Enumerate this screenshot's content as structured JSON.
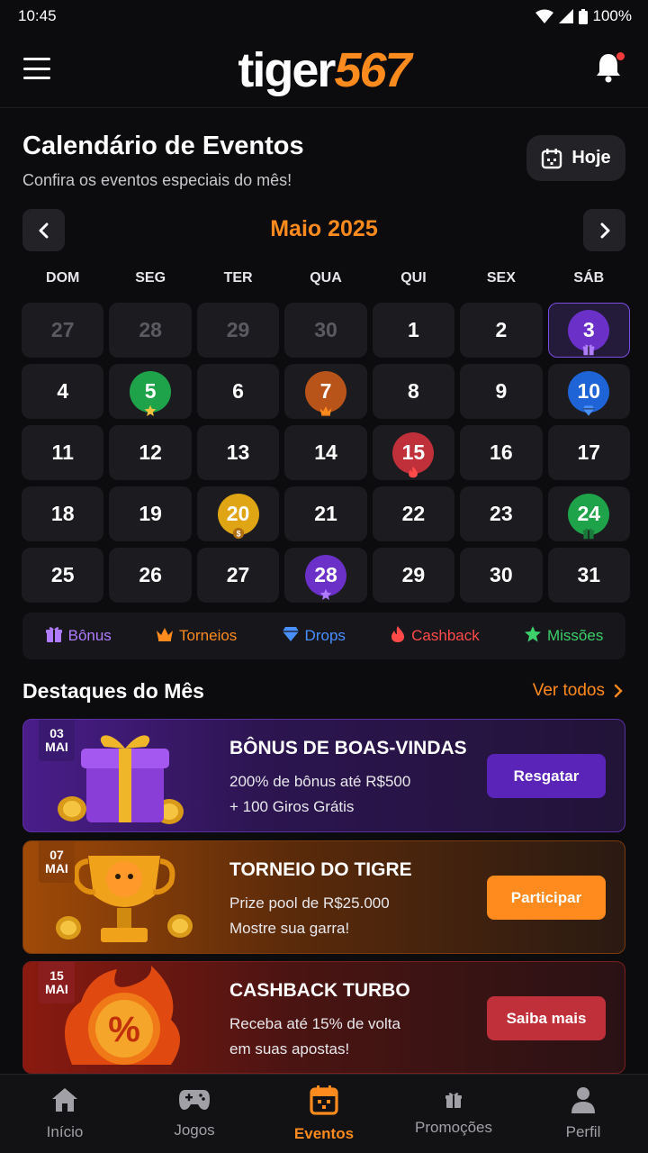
{
  "status_bar": {
    "time": "10:45",
    "battery": "100%"
  },
  "header": {
    "logo_part1": "tiger",
    "logo_part2": "567"
  },
  "page": {
    "title": "Calendário de Eventos",
    "subtitle": "Confira os eventos especiais do mês!",
    "today_label": "Hoje"
  },
  "calendar": {
    "month_label": "Maio 2025",
    "weekdays": [
      "DOM",
      "SEG",
      "TER",
      "QUA",
      "QUI",
      "SEX",
      "SÁB"
    ],
    "days": [
      {
        "n": "27",
        "muted": true
      },
      {
        "n": "28",
        "muted": true
      },
      {
        "n": "29",
        "muted": true
      },
      {
        "n": "30",
        "muted": true
      },
      {
        "n": "1"
      },
      {
        "n": "2"
      },
      {
        "n": "3",
        "event": "bonus",
        "today": true
      },
      {
        "n": "4"
      },
      {
        "n": "5",
        "event": "missoes"
      },
      {
        "n": "6"
      },
      {
        "n": "7",
        "event": "torneios"
      },
      {
        "n": "8"
      },
      {
        "n": "9"
      },
      {
        "n": "10",
        "event": "drops"
      },
      {
        "n": "11"
      },
      {
        "n": "12"
      },
      {
        "n": "13"
      },
      {
        "n": "14"
      },
      {
        "n": "15",
        "event": "cashback"
      },
      {
        "n": "16"
      },
      {
        "n": "17"
      },
      {
        "n": "18"
      },
      {
        "n": "19"
      },
      {
        "n": "20",
        "event": "coin"
      },
      {
        "n": "21"
      },
      {
        "n": "22"
      },
      {
        "n": "23"
      },
      {
        "n": "24",
        "event": "gift-green"
      },
      {
        "n": "25"
      },
      {
        "n": "26"
      },
      {
        "n": "27"
      },
      {
        "n": "28",
        "event": "star-purple"
      },
      {
        "n": "29"
      },
      {
        "n": "30"
      },
      {
        "n": "31"
      }
    ],
    "event_colors": {
      "bonus": "#6a30c8",
      "missoes": "#1fa34a",
      "torneios": "#b8541a",
      "drops": "#1f64d6",
      "cashback": "#c0303a",
      "coin": "#e0a514",
      "gift-green": "#1fa34a",
      "star-purple": "#6a30c8"
    }
  },
  "legend": [
    {
      "label": "Bônus",
      "color": "#b07cff",
      "icon": "gift-icon"
    },
    {
      "label": "Torneios",
      "color": "#ff8a1e",
      "icon": "crown-icon"
    },
    {
      "label": "Drops",
      "color": "#4a8fff",
      "icon": "diamond-icon"
    },
    {
      "label": "Cashback",
      "color": "#ff4a4a",
      "icon": "fire-icon"
    },
    {
      "label": "Missões",
      "color": "#3ccf6a",
      "icon": "star-icon"
    }
  ],
  "highlights": {
    "title": "Destaques do Mês",
    "see_all": "Ver todos",
    "cards": [
      {
        "day": "03",
        "month": "MAI",
        "title": "BÔNUS DE BOAS-VINDAS",
        "line1": "200% de bônus até R$500",
        "line2": "+ 100 Giros Grátis",
        "button": "Resgatar"
      },
      {
        "day": "07",
        "month": "MAI",
        "title": "TORNEIO DO TIGRE",
        "line1": "Prize pool de R$25.000",
        "line2": "Mostre sua garra!",
        "button": "Participar"
      },
      {
        "day": "15",
        "month": "MAI",
        "title": "CASHBACK TURBO",
        "line1": "Receba até 15% de volta",
        "line2": "em suas apostas!",
        "button": "Saiba mais"
      }
    ]
  },
  "bottom_nav": [
    {
      "label": "Início",
      "icon": "home-icon"
    },
    {
      "label": "Jogos",
      "icon": "gamepad-icon"
    },
    {
      "label": "Eventos",
      "icon": "calendar-icon",
      "active": true
    },
    {
      "label": "Promoções",
      "icon": "gift-icon"
    },
    {
      "label": "Perfil",
      "icon": "user-icon"
    }
  ]
}
